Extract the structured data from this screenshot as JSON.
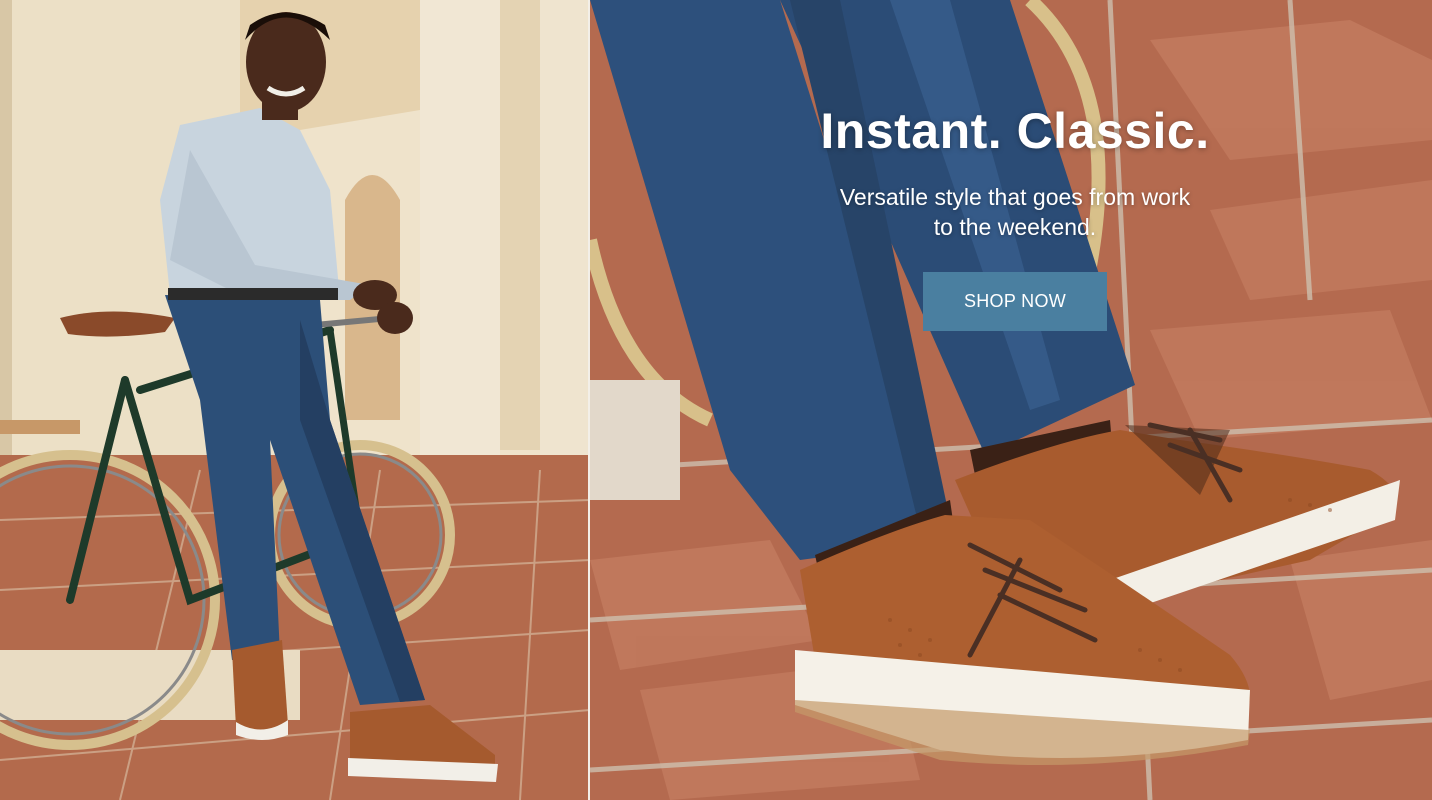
{
  "hero": {
    "headline": "Instant. Classic.",
    "subhead": "Versatile style that goes from work to the weekend.",
    "cta_label": "SHOP NOW"
  },
  "colors": {
    "cta_background": "#4a7fa0",
    "text": "#ffffff",
    "brick": "#b0664a",
    "trousers": "#2c4f78",
    "leather": "#a55a2e"
  },
  "images": [
    {
      "name": "man-with-bicycle-photo"
    },
    {
      "name": "sneakers-closeup-photo"
    }
  ]
}
